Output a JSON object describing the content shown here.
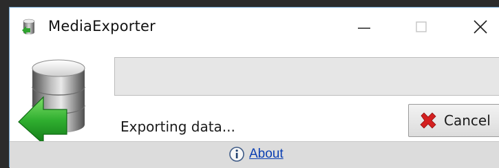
{
  "window": {
    "title": "MediaExporter",
    "controls": {
      "minimize_icon": "minimize-icon",
      "maximize_icon": "maximize-icon",
      "close_icon": "close-icon"
    }
  },
  "main": {
    "app_icon": "database-export-icon",
    "progress": {
      "fraction": 0.0,
      "fill_color": "#06b025"
    },
    "status_text": "Exporting data...",
    "cancel_button": {
      "label": "Cancel",
      "icon": "red-x-icon"
    }
  },
  "footer": {
    "about_icon": "info-icon",
    "about_label": "About"
  }
}
